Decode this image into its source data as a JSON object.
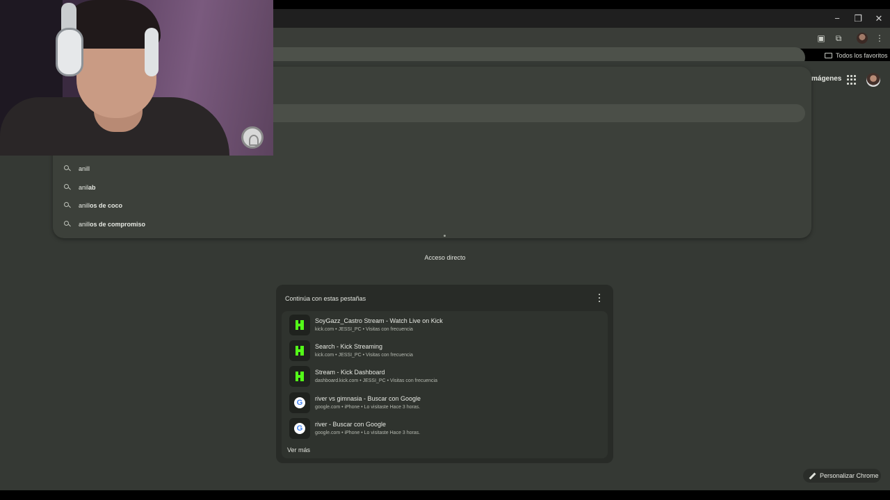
{
  "window": {
    "minimize_glyph": "−",
    "maximize_glyph": "❐",
    "close_glyph": "✕"
  },
  "toolbar": {
    "extension_icon_1": "extension-photo-icon",
    "extension_icon_2": "puzzle-icon",
    "menu_glyph": "⋮"
  },
  "bookmarks": {
    "all_bookmarks_label": "Todos los favoritos"
  },
  "ntp_header": {
    "images_link": "mágenes"
  },
  "suggestions": [
    {
      "normal": "anill",
      "bold": ""
    },
    {
      "normal": "anil",
      "bold": "ab"
    },
    {
      "normal": "anill",
      "bold": "os de coco"
    },
    {
      "normal": "anill",
      "bold": "os de compromiso"
    }
  ],
  "shortcut": {
    "label": "Acceso directo"
  },
  "continue_card": {
    "title": "Continúa con estas pestañas",
    "tabs": [
      {
        "icon": "kick-icon",
        "title": "SoyGazz_Castro Stream - Watch Live on Kick",
        "meta": "kick.com • JESSI_PC • Visitas con frecuencia"
      },
      {
        "icon": "kick-icon",
        "title": "Search - Kick Streaming",
        "meta": "kick.com • JESSI_PC • Visitas con frecuencia"
      },
      {
        "icon": "kick-icon",
        "title": "Stream - Kick Dashboard",
        "meta": "dashboard.kick.com • JESSI_PC • Visitas con frecuencia"
      },
      {
        "icon": "google-icon",
        "title": "river vs gimnasia - Buscar con Google",
        "meta": "google.com • iPhone • Lo visitaste Hace 3 horas."
      },
      {
        "icon": "google-icon",
        "title": "river - Buscar con Google",
        "meta": "google.com • iPhone • Lo visitaste Hace 3 horas."
      }
    ],
    "see_more": "Ver más",
    "google_letter": "G"
  },
  "customize": {
    "label": "Personalizar Chrome"
  },
  "colors": {
    "kick_green": "#53fc18",
    "page_bg": "#353934",
    "card_bg": "#282b27"
  }
}
